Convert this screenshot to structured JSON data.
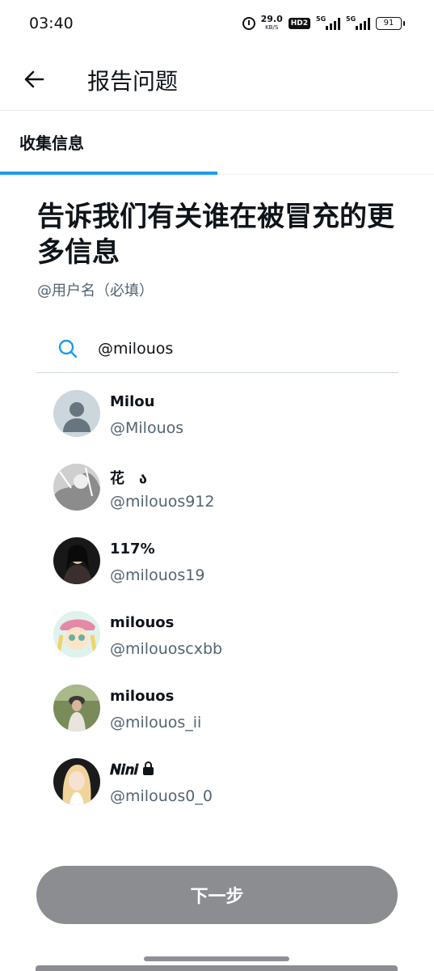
{
  "status_bar": {
    "time": "03:40",
    "net_speed": "29.0",
    "net_unit": "KB/S",
    "hd": "HD2",
    "signal_1": "5G",
    "signal_2": "5G",
    "battery": "91",
    "icons": [
      "alarm-icon",
      "signal-icon",
      "battery-icon"
    ]
  },
  "header": {
    "back_icon": "arrow-left-icon",
    "title": "报告问题"
  },
  "tab": {
    "label": "收集信息",
    "progress": 0.5,
    "accent_color": "#1d9bf0"
  },
  "main": {
    "heading": "告诉我们有关谁在被冒充的更多信息",
    "field_label": "@用户名（必填）",
    "search": {
      "icon": "search-icon",
      "value": "@milouos"
    }
  },
  "results": [
    {
      "name": "Milou",
      "handle": "@Milouos",
      "avatar": "default-avatar"
    },
    {
      "name": "花　ა",
      "handle": "@milouos912",
      "avatar": "photo-avatar"
    },
    {
      "name": "117%",
      "handle": "@milouos19",
      "avatar": "photo-avatar"
    },
    {
      "name": "milouos",
      "handle": "@milouoscxbb",
      "avatar": "photo-avatar"
    },
    {
      "name": "milouos",
      "handle": "@milouos_ii",
      "avatar": "photo-avatar"
    },
    {
      "name": "𝑵𝒊𝒏𝒊",
      "handle": "@milouos0_0",
      "avatar": "photo-avatar",
      "protected": true
    }
  ],
  "footer": {
    "next_label": "下一步",
    "button_color": "#8b8d91"
  }
}
